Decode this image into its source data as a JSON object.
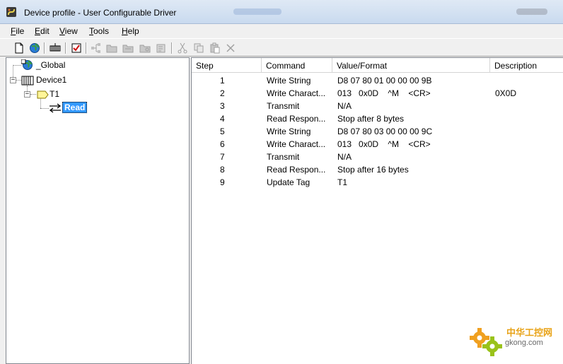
{
  "window": {
    "title": "Device profile - User Configurable Driver"
  },
  "menu": {
    "items": [
      {
        "label": "File",
        "accel": "F",
        "rest": "ile"
      },
      {
        "label": "Edit",
        "accel": "E",
        "rest": "dit"
      },
      {
        "label": "View",
        "accel": "V",
        "rest": "iew"
      },
      {
        "label": "Tools",
        "accel": "T",
        "rest": "ools"
      },
      {
        "label": "Help",
        "accel": "H",
        "rest": "elp"
      }
    ]
  },
  "toolbar": {
    "icons": [
      "new-file-icon",
      "globe-icon",
      "device-icon",
      "tag-icon",
      "tree-add-icon",
      "folder-add-icon",
      "folder-open-icon",
      "folder-settings-icon",
      "properties-icon",
      "cut-icon",
      "copy-icon",
      "paste-icon",
      "delete-icon"
    ]
  },
  "tree": {
    "global": "_Global",
    "device": "Device1",
    "tag": "T1",
    "transaction": "Read"
  },
  "list": {
    "columns": [
      "Step",
      "Command",
      "Value/Format",
      "Description"
    ],
    "rows": [
      {
        "step": "1",
        "command": "Write String",
        "value": "D8 07 80 01 00 00 00 9B",
        "description": ""
      },
      {
        "step": "2",
        "command": "Write Charact...",
        "value": "013   0x0D    ^M    <CR>",
        "description": "0X0D"
      },
      {
        "step": "3",
        "command": "Transmit",
        "value": "N/A",
        "description": ""
      },
      {
        "step": "4",
        "command": "Read Respon...",
        "value": "Stop after 8 bytes",
        "description": ""
      },
      {
        "step": "5",
        "command": "Write String",
        "value": "D8 07 80 03 00 00 00 9C",
        "description": ""
      },
      {
        "step": "6",
        "command": "Write Charact...",
        "value": "013   0x0D    ^M    <CR>",
        "description": ""
      },
      {
        "step": "7",
        "command": "Transmit",
        "value": "N/A",
        "description": ""
      },
      {
        "step": "8",
        "command": "Read Respon...",
        "value": "Stop after 16 bytes",
        "description": ""
      },
      {
        "step": "9",
        "command": "Update Tag",
        "value": "T1",
        "description": ""
      }
    ]
  },
  "watermark": {
    "brand": "中华工控网",
    "domain": "gkong.com"
  },
  "colors": {
    "selection": "#3399ff",
    "title_bar": "#c9daef"
  }
}
